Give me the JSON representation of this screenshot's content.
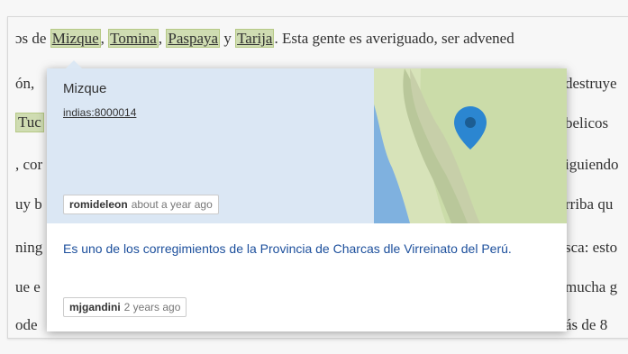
{
  "background_text": {
    "line1": {
      "prefix": "ɔs de ",
      "tags": [
        "Mizque",
        "Tomina",
        "Paspaya",
        "Tarija"
      ],
      "sep1": ", ",
      "sep2": ", ",
      "sep3": " y ",
      "suffix": ". Esta gente es averiguado, ser advened"
    },
    "left_fragments": [
      "ón, ",
      "Tuc",
      ", cor",
      "uy b",
      "ning",
      "ue e",
      "ode"
    ],
    "right_fragments": [
      "destruye",
      "belicos",
      "iguiendo",
      "rriba qu",
      "sca: esto",
      "mucha g",
      "ás de 8"
    ]
  },
  "popup": {
    "title": "Mizque",
    "id_link": "indias:8000014",
    "header_author": "romideleon",
    "header_time": "about a year ago",
    "description": "Es uno de los corregimientos de la Provincia de Charcas dle Virreinato del Perú.",
    "footer_author": "mjgandini",
    "footer_time": "2 years ago",
    "map_pin_icon": "map-pin-icon",
    "accent": "#2b86d1"
  }
}
